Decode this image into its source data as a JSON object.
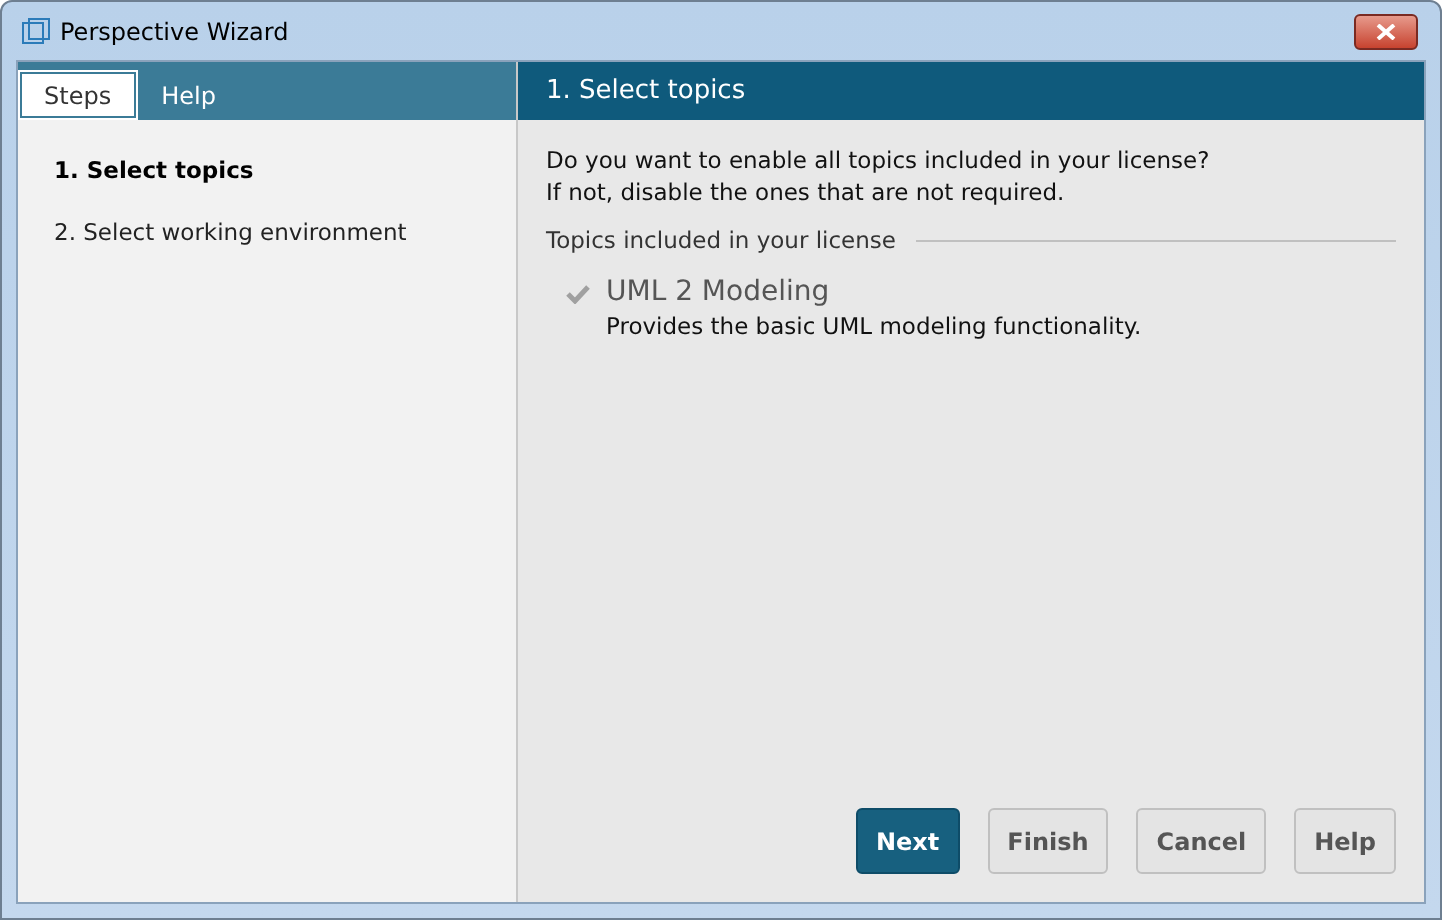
{
  "window": {
    "title": "Perspective Wizard"
  },
  "tabs": [
    {
      "label": "Steps",
      "selected": true
    },
    {
      "label": "Help",
      "selected": false
    }
  ],
  "steps": [
    {
      "label": "1. Select topics",
      "selected": true
    },
    {
      "label": "2. Select working environment",
      "selected": false
    }
  ],
  "page": {
    "title": "1. Select topics",
    "intro": [
      "Do you want to enable all topics included in your license?",
      "If not, disable the ones that are not required."
    ],
    "group_title": "Topics included in your license",
    "topics": [
      {
        "name": "UML 2 Modeling",
        "description": "Provides the basic UML modeling functionality.",
        "checked": true
      }
    ]
  },
  "buttons": [
    {
      "label": "Next",
      "kind": "primary"
    },
    {
      "label": "Finish",
      "kind": "secondary"
    },
    {
      "label": "Cancel",
      "kind": "secondary"
    },
    {
      "label": "Help",
      "kind": "secondary"
    }
  ]
}
